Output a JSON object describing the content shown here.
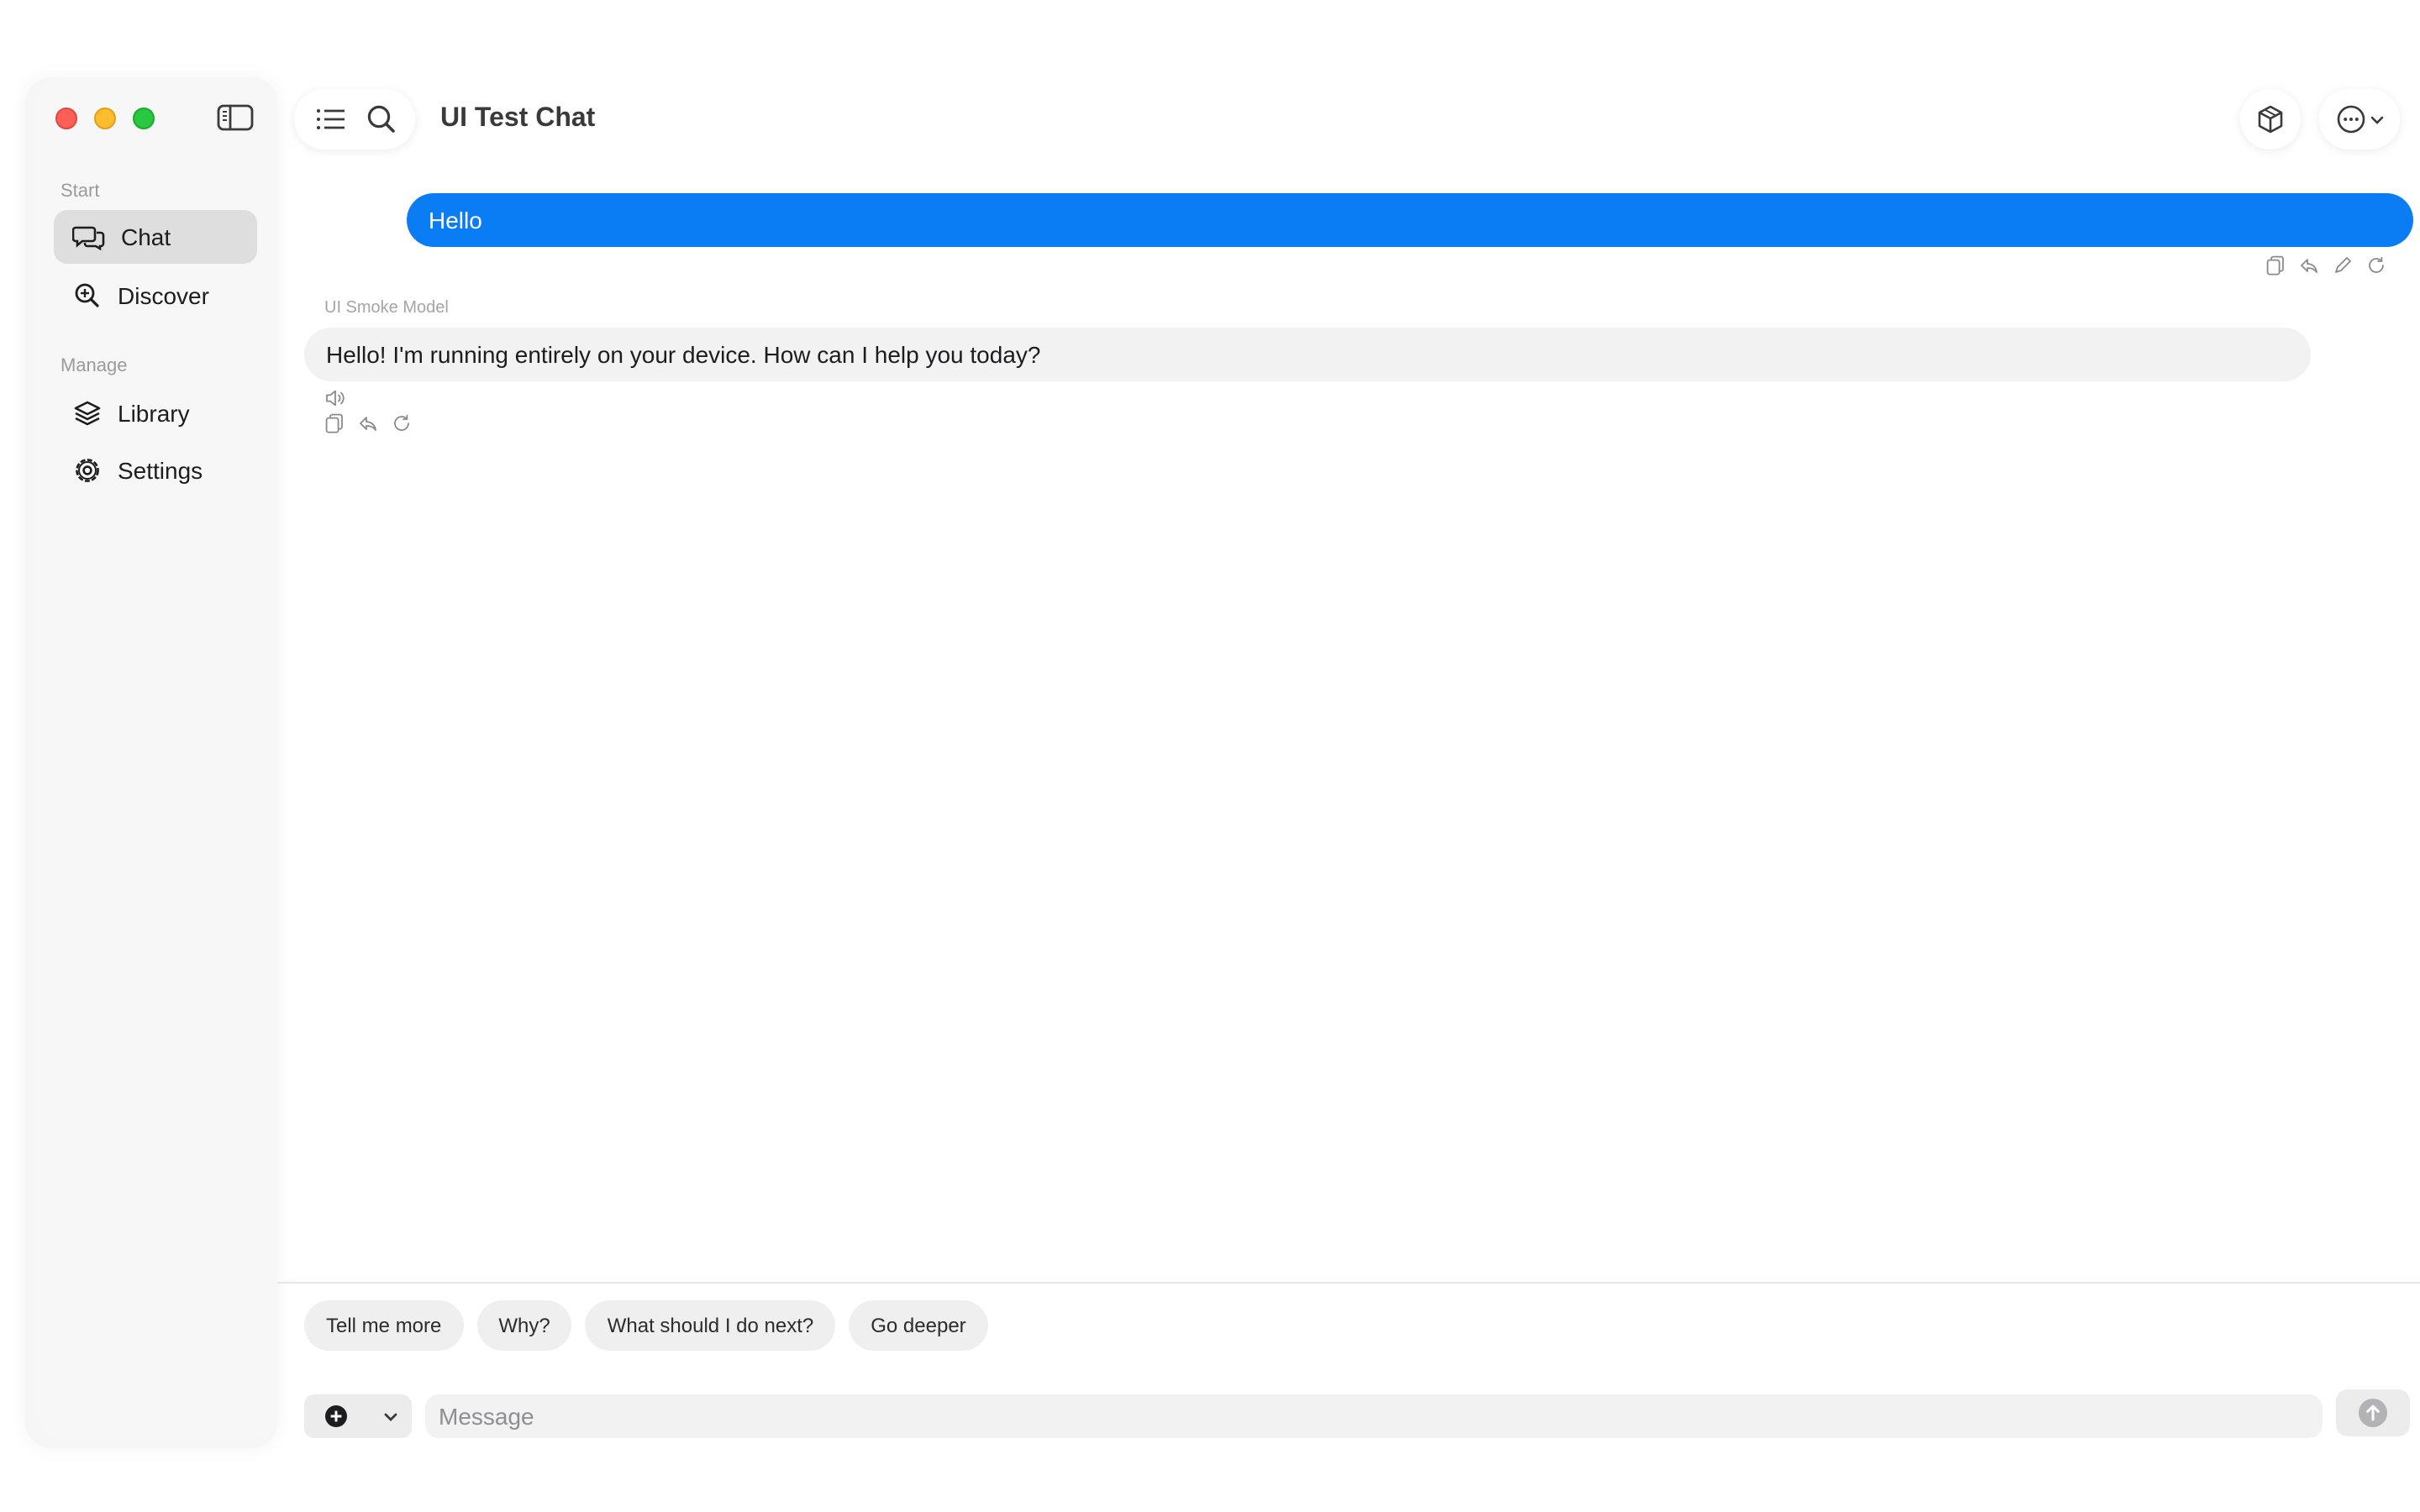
{
  "sidebar": {
    "sections": [
      {
        "label": "Start"
      },
      {
        "label": "Manage"
      }
    ],
    "items": [
      {
        "label": "Chat",
        "icon": "chat-bubbles-icon",
        "active": true
      },
      {
        "label": "Discover",
        "icon": "discover-magnifier-icon"
      },
      {
        "label": "Library",
        "icon": "layers-icon"
      },
      {
        "label": "Settings",
        "icon": "gear-icon"
      }
    ]
  },
  "toolbar": {
    "title": "UI Test Chat",
    "left_icons": [
      "list-icon",
      "search-icon"
    ],
    "right_icons": [
      "model-cube-icon",
      "more-ellipsis-icon"
    ]
  },
  "conversation": {
    "user_message": "Hello",
    "model_name": "UI Smoke Model",
    "assistant_message": "Hello! I'm running entirely on your device. How can I help you today?"
  },
  "composer": {
    "suggestions": [
      "Tell me more",
      "Why?",
      "What should I do next?",
      "Go deeper"
    ],
    "placeholder": "Message",
    "value": ""
  },
  "colors": {
    "accent": "#0a7cf4",
    "traffic_red": "#ff5f57",
    "traffic_yellow": "#febc2e",
    "traffic_green": "#28c840"
  }
}
